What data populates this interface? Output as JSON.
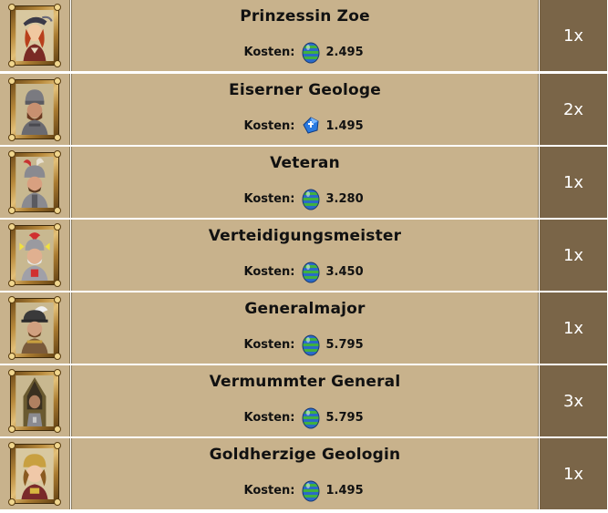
{
  "colors": {
    "row_background": "#c8b28c",
    "quantity_background": "#7a6548",
    "row_separator": "#ffffff",
    "quantity_text": "#ffffff"
  },
  "items": [
    {
      "name": "Prinzessin Zoe",
      "cost_label": "Kosten:",
      "cost_icon": "blue-green-egg-icon",
      "cost_value": "2.495",
      "quantity": "1x",
      "portrait": "princess-portrait-icon"
    },
    {
      "name": "Eiserner Geologe",
      "cost_label": "Kosten:",
      "cost_icon": "blue-gem-icon",
      "cost_value": "1.495",
      "quantity": "2x",
      "portrait": "iron-geologist-portrait-icon"
    },
    {
      "name": "Veteran",
      "cost_label": "Kosten:",
      "cost_icon": "blue-green-egg-icon",
      "cost_value": "3.280",
      "quantity": "1x",
      "portrait": "veteran-portrait-icon"
    },
    {
      "name": "Verteidigungsmeister",
      "cost_label": "Kosten:",
      "cost_icon": "blue-green-egg-icon",
      "cost_value": "3.450",
      "quantity": "1x",
      "portrait": "defense-master-portrait-icon"
    },
    {
      "name": "Generalmajor",
      "cost_label": "Kosten:",
      "cost_icon": "blue-green-egg-icon",
      "cost_value": "5.795",
      "quantity": "1x",
      "portrait": "major-general-portrait-icon"
    },
    {
      "name": "Vermummter General",
      "cost_label": "Kosten:",
      "cost_icon": "blue-green-egg-icon",
      "cost_value": "5.795",
      "quantity": "3x",
      "portrait": "hooded-general-portrait-icon"
    },
    {
      "name": "Goldherzige Geologin",
      "cost_label": "Kosten:",
      "cost_icon": "blue-green-egg-icon",
      "cost_value": "1.495",
      "quantity": "1x",
      "portrait": "goldhearted-geologist-portrait-icon"
    }
  ]
}
